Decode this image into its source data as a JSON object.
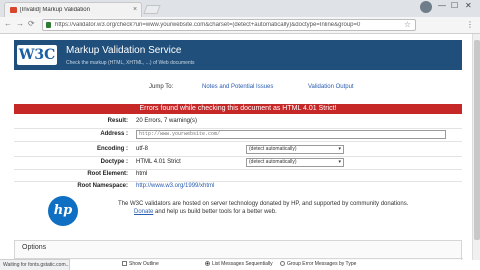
{
  "browser": {
    "tab_title": "[Invalid] Markup Validation",
    "tab_close": "×",
    "url": "https://validator.w3.org/check?uri=www.yourwebsite.com&charset=(detect+automatically)&doctype=Inline&group=0",
    "back": "←",
    "forward": "→",
    "reload": "⟳",
    "minimize": "—",
    "maximize": "☐",
    "close": "✕",
    "star": "☆",
    "menu": "⋮"
  },
  "header": {
    "logo": "W3C",
    "title": "Markup Validation Service",
    "subtitle": "Check the markup (HTML, XHTML, ...) of Web documents"
  },
  "jump": {
    "label": "Jump To:",
    "links": [
      "Notes and Potential Issues",
      "Validation Output"
    ]
  },
  "banner": "Errors found while checking this document as HTML 4.01 Strict!",
  "results": {
    "result_label": "Result:",
    "result_value": "20 Errors, 7 warning(s)",
    "address_label": "Address :",
    "address_value": "http://www.yourwebsite.com/",
    "encoding_label": "Encoding :",
    "encoding_value": "utf-8",
    "encoding_select": "(detect automatically)",
    "doctype_label": "Doctype :",
    "doctype_value": "HTML 4.01 Strict",
    "doctype_select": "(detect automatically)",
    "root_element_label": "Root Element:",
    "root_element_value": "html",
    "root_namespace_label": "Root Namespace:",
    "root_namespace_value": "http://www.w3.org/1999/xhtml"
  },
  "sponsor": {
    "logo": "hp",
    "line1": "The W3C validators are hosted on server technology donated by HP, and supported by community donations.",
    "donate": "Donate",
    "line2_rest": "and help us build better tools for a better web."
  },
  "options": {
    "title": "Options",
    "show_outline": "Show Outline",
    "list_sequential": "List Messages Sequentially",
    "group_by_type": "Group Error Messages by Type"
  },
  "status": "Waiting for fonts.gstatic.com..."
}
